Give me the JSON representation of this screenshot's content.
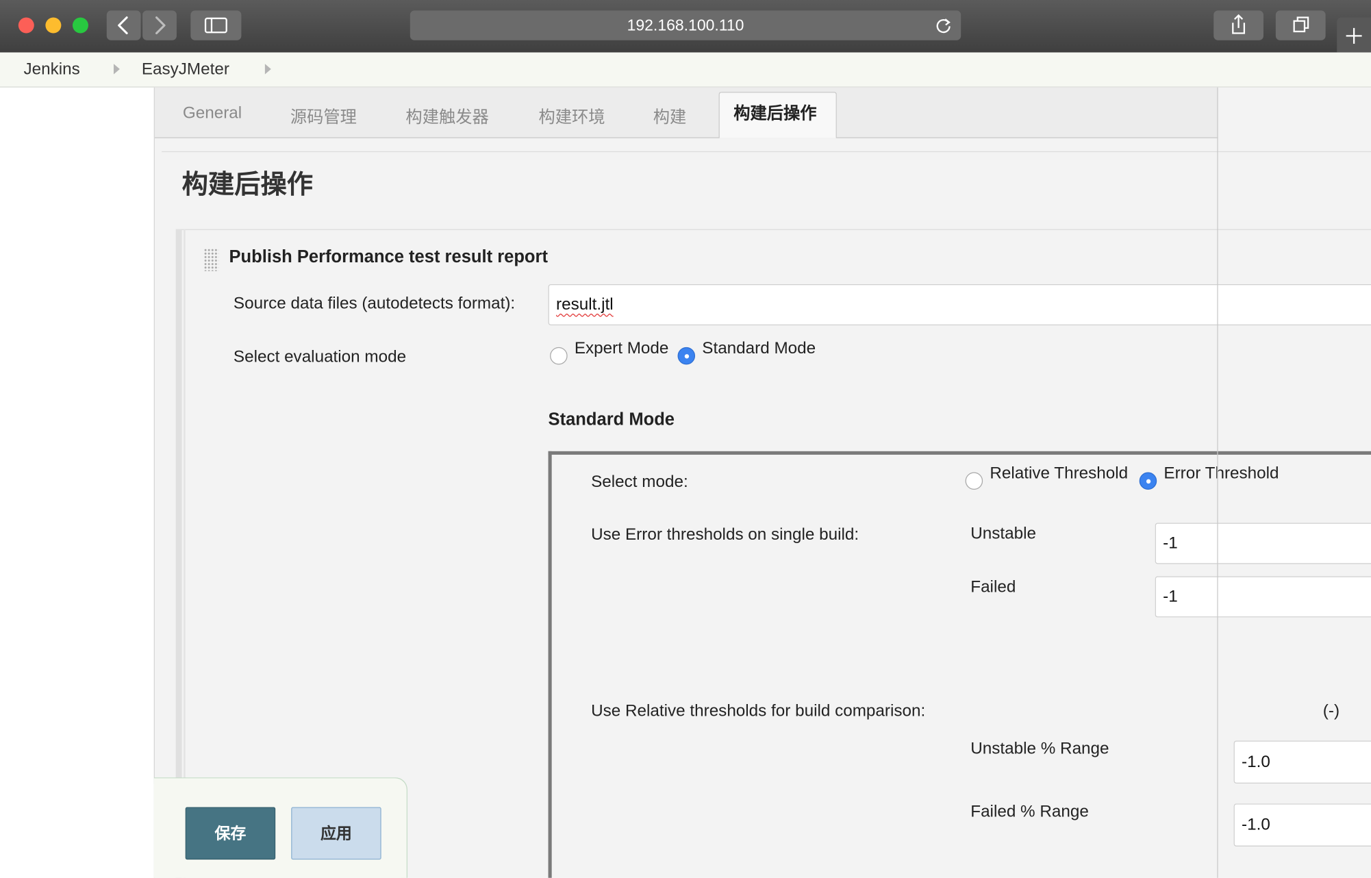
{
  "browser": {
    "url": "192.168.100.110"
  },
  "breadcrumb": {
    "items": [
      "Jenkins",
      "EasyJMeter"
    ]
  },
  "tabs": [
    {
      "label": "General"
    },
    {
      "label": "源码管理"
    },
    {
      "label": "构建触发器"
    },
    {
      "label": "构建环境"
    },
    {
      "label": "构建"
    },
    {
      "label": "构建后操作",
      "active": true
    }
  ],
  "section": {
    "title": "构建后操作",
    "publisher_title": "Publish Performance test result report",
    "source_label": "Source data files (autodetects format):",
    "source_value": "result.jtl",
    "eval_label": "Select evaluation mode",
    "eval_options": {
      "expert": "Expert Mode",
      "standard": "Standard Mode",
      "selected": "standard"
    },
    "standard_mode_title": "Standard Mode"
  },
  "standard_mode": {
    "select_mode_label": "Select mode:",
    "mode_options": {
      "relative": "Relative Threshold",
      "error": "Error Threshold",
      "selected": "error"
    },
    "error_thresholds_label": "Use Error thresholds on single build:",
    "unstable_label": "Unstable",
    "unstable_value": "-1",
    "failed_label": "Failed",
    "failed_value": "-1",
    "relative_label": "Use Relative thresholds for build comparison:",
    "relative_toggle": "(-)",
    "unstable_range_label": "Unstable % Range",
    "unstable_range_value": "-1.0",
    "failed_range_label": "Failed % Range",
    "failed_range_value": "-1.0"
  },
  "actions": {
    "save": "保存",
    "apply": "应用"
  }
}
